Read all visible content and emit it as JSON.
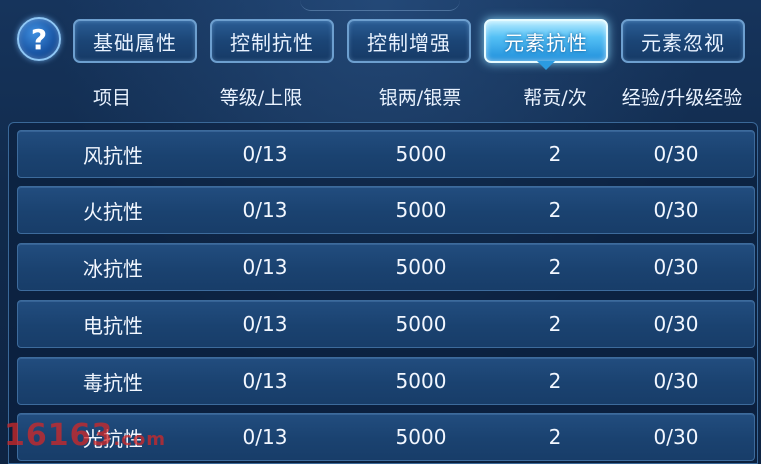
{
  "help_button": {
    "glyph": "?",
    "icon": "question-icon"
  },
  "tabs": [
    {
      "label": "基础属性",
      "active": false
    },
    {
      "label": "控制抗性",
      "active": false
    },
    {
      "label": "控制增强",
      "active": false
    },
    {
      "label": "元素抗性",
      "active": true
    },
    {
      "label": "元素忽视",
      "active": false
    }
  ],
  "table": {
    "headers": [
      "项目",
      "等级/上限",
      "银两/银票",
      "帮贡/次",
      "经验/升级经验"
    ],
    "rows": [
      [
        "风抗性",
        "0/13",
        "5000",
        "2",
        "0/30"
      ],
      [
        "火抗性",
        "0/13",
        "5000",
        "2",
        "0/30"
      ],
      [
        "冰抗性",
        "0/13",
        "5000",
        "2",
        "0/30"
      ],
      [
        "电抗性",
        "0/13",
        "5000",
        "2",
        "0/30"
      ],
      [
        "毒抗性",
        "0/13",
        "5000",
        "2",
        "0/30"
      ],
      [
        "光抗性",
        "0/13",
        "5000",
        "2",
        "0/30"
      ]
    ]
  },
  "watermark": {
    "main": "16163",
    "suffix": ".com"
  },
  "colors": {
    "accent_active_tab": "#54c0f5",
    "tab_border": "#6d9fcf",
    "background": "#0f2747",
    "watermark": "#d22828"
  }
}
